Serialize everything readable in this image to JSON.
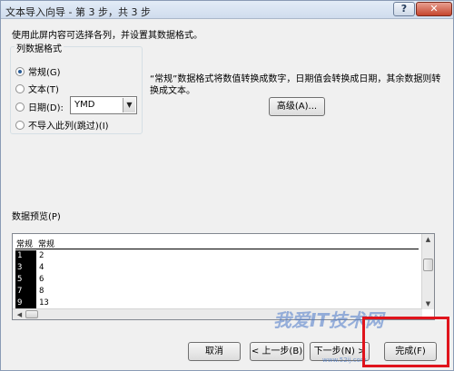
{
  "window": {
    "title": "文本导入向导 - 第 3 步，共 3 步",
    "help_label": "?",
    "close_label": "✕"
  },
  "instruction": "使用此屏内容可选择各列，并设置其数据格式。",
  "column_format": {
    "legend": "列数据格式",
    "options": [
      {
        "label": "常规(G)",
        "checked": true
      },
      {
        "label": "文本(T)",
        "checked": false
      },
      {
        "label": "日期(D):",
        "checked": false
      },
      {
        "label": "不导入此列(跳过)(I)",
        "checked": false
      }
    ],
    "date_value": "YMD"
  },
  "description": "“常规”数据格式将数值转换成数字，日期值会转换成日期，其余数据则转换成文本。",
  "advanced_button": "高级(A)...",
  "preview": {
    "label": "数据预览(P)",
    "headers": [
      "常规",
      "常规"
    ],
    "rows": [
      [
        "1",
        "2"
      ],
      [
        "3",
        "4"
      ],
      [
        "5",
        "6"
      ],
      [
        "7",
        "8"
      ],
      [
        "9",
        "13"
      ]
    ]
  },
  "buttons": {
    "cancel": "取消",
    "back": "< 上一步(B)",
    "next": "下一步(N) >",
    "finish": "完成(F)"
  },
  "watermark": {
    "main": "我爱IT技术网",
    "sub": "www.52ij.com"
  }
}
